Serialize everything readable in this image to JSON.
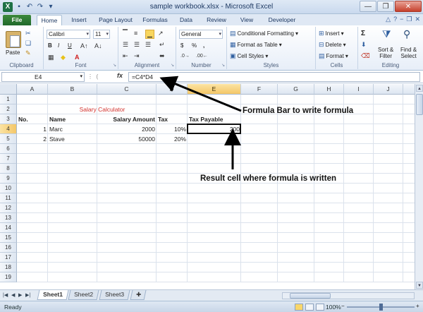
{
  "window": {
    "title": "sample workbook.xlsx - Microsoft Excel",
    "app_icon": "X",
    "controls": [
      "—",
      "❐",
      "✕"
    ]
  },
  "ribbon": {
    "tabs": [
      "File",
      "Home",
      "Insert",
      "Page Layout",
      "Formulas",
      "Data",
      "Review",
      "View",
      "Developer"
    ],
    "active_tab": "Home",
    "clipboard": {
      "label": "Clipboard",
      "paste": "Paste"
    },
    "font": {
      "label": "Font",
      "name": "Calibri",
      "size": "11",
      "bold": "B",
      "italic": "I",
      "underline": "U"
    },
    "alignment": {
      "label": "Alignment"
    },
    "number": {
      "label": "Number",
      "format": "General",
      "currency": "$",
      "percent": "%",
      "comma": ","
    },
    "styles": {
      "label": "Styles",
      "conditional": "Conditional Formatting",
      "format_table": "Format as Table",
      "cell_styles": "Cell Styles"
    },
    "cells": {
      "label": "Cells",
      "insert": "Insert",
      "delete": "Delete",
      "format": "Format"
    },
    "editing": {
      "label": "Editing",
      "sum": "Σ",
      "sort": "Sort &",
      "sort2": "Filter",
      "find": "Find &",
      "find2": "Select"
    }
  },
  "formula_bar": {
    "name_box": "E4",
    "fx": "fx",
    "formula": "=C4*D4"
  },
  "sheet": {
    "columns": [
      "A",
      "B",
      "C",
      "D",
      "E",
      "F",
      "G",
      "H",
      "I",
      "J"
    ],
    "rows": [
      "1",
      "2",
      "3",
      "4",
      "5",
      "6",
      "7",
      "8",
      "9",
      "10",
      "11",
      "12",
      "13",
      "14",
      "15",
      "16",
      "17",
      "18",
      "19"
    ],
    "active_cell": "E4",
    "title": "Salary Calculator",
    "headers": {
      "no": "No.",
      "name": "Name",
      "salary": "Salary Amount",
      "tax": "Tax",
      "payable": "Tax Payable"
    },
    "data": [
      {
        "no": "1",
        "name": "Marc",
        "salary": "2000",
        "tax": "10%",
        "payable": "200"
      },
      {
        "no": "2",
        "name": "Stave",
        "salary": "50000",
        "tax": "20%",
        "payable": ""
      }
    ]
  },
  "annotations": {
    "formula_bar": "Formula Bar to write formula",
    "result_cell": "Result cell where formula is written"
  },
  "sheet_tabs": [
    "Sheet1",
    "Sheet2",
    "Sheet3"
  ],
  "status": {
    "ready": "Ready",
    "zoom": "100%",
    "minus": "−",
    "plus": "+"
  }
}
